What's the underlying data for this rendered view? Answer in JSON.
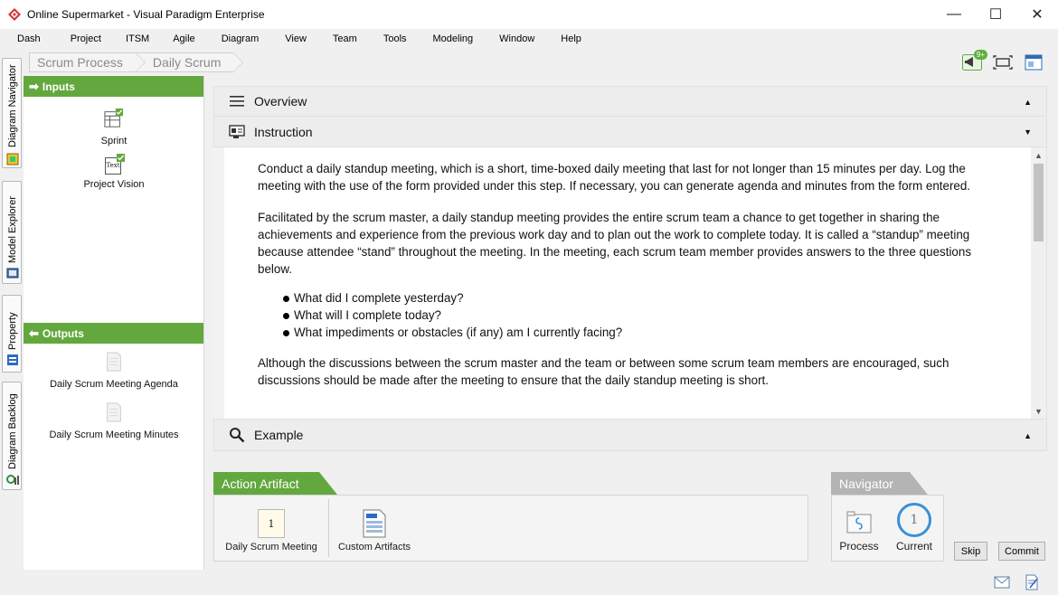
{
  "window": {
    "title": "Online Supermarket - Visual Paradigm Enterprise",
    "minimize": "—",
    "maximize": "☐",
    "close": "✕"
  },
  "menu": [
    "Dash",
    "Project",
    "ITSM",
    "Agile",
    "Diagram",
    "View",
    "Team",
    "Tools",
    "Modeling",
    "Window",
    "Help"
  ],
  "vtabs": [
    "Diagram Navigator",
    "Model Explorer",
    "Property",
    "Diagram Backlog"
  ],
  "breadcrumb": [
    "Scrum Process",
    "Daily Scrum"
  ],
  "top_icons": {
    "notification_badge": "9+"
  },
  "left_panel": {
    "inputs_label": "Inputs",
    "inputs": [
      {
        "label": "Sprint",
        "icon": "table-doc-icon"
      },
      {
        "label": "Project Vision",
        "icon": "text-doc-icon",
        "icon_text": "Text"
      }
    ],
    "outputs_label": "Outputs",
    "outputs": [
      {
        "label": "Daily Scrum Meeting Agenda",
        "icon": "blank-doc-icon"
      },
      {
        "label": "Daily Scrum Meeting Minutes",
        "icon": "blank-doc-icon"
      }
    ]
  },
  "accordion": {
    "overview": "Overview",
    "instruction": "Instruction",
    "example": "Example"
  },
  "instruction": {
    "p1": "Conduct a daily standup meeting, which is a short, time-boxed daily meeting that last for not longer than 15 minutes per day. Log the meeting with the use of the form provided under this step. If necessary, you can generate agenda and minutes from the form entered.",
    "p2": "Facilitated by the scrum master, a daily standup meeting provides the entire scrum team a chance to get together in sharing the achievements and experience from the previous work day and to plan out the work to complete today. It is called a “standup” meeting because attendee “stand” throughout the meeting. In the meeting, each scrum team member provides answers to the three questions below.",
    "bullets": [
      "What did I complete yesterday?",
      "What will I complete today?",
      "What impediments or obstacles (if any) am I currently facing?"
    ],
    "p3": "Although the discussions between the scrum master and the team or between some scrum team members are encouraged, such discussions should be made after the meeting to ensure that the daily standup meeting is short."
  },
  "action_artifact": {
    "title": "Action Artifact",
    "items": [
      {
        "label": "Daily Scrum Meeting",
        "icon_text": "1"
      },
      {
        "label": "Custom Artifacts"
      }
    ]
  },
  "navigator": {
    "title": "Navigator",
    "process": "Process",
    "current": "Current",
    "current_number": "1"
  },
  "buttons": {
    "skip": "Skip",
    "commit": "Commit"
  },
  "colors": {
    "accent_green": "#63a83f",
    "navigator_gray": "#b4b4b4",
    "current_ring": "#3b8fd6"
  }
}
